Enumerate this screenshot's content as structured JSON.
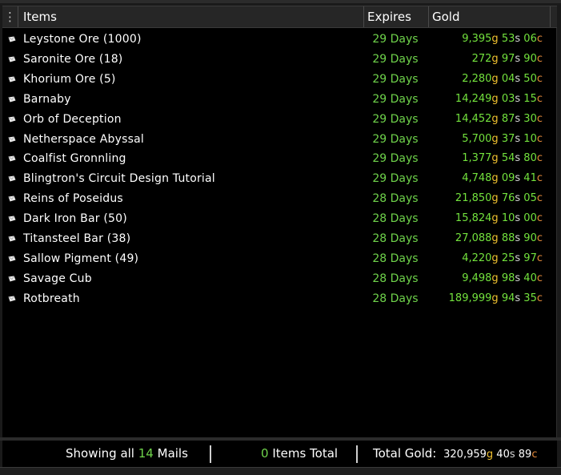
{
  "header": {
    "menu_glyph": "⋮",
    "col_items": "Items",
    "col_expires": "Expires",
    "col_gold": "Gold"
  },
  "rows": [
    {
      "name": "Leystone Ore (1000)",
      "expires": "29 Days",
      "gold": "9,395",
      "silver": "53",
      "copper": "06"
    },
    {
      "name": "Saronite Ore (18)",
      "expires": "29 Days",
      "gold": "272",
      "silver": "97",
      "copper": "90"
    },
    {
      "name": "Khorium Ore (5)",
      "expires": "29 Days",
      "gold": "2,280",
      "silver": "04",
      "copper": "50"
    },
    {
      "name": "Barnaby",
      "expires": "29 Days",
      "gold": "14,249",
      "silver": "03",
      "copper": "15"
    },
    {
      "name": "Orb of Deception",
      "expires": "29 Days",
      "gold": "14,452",
      "silver": "87",
      "copper": "30"
    },
    {
      "name": "Netherspace Abyssal",
      "expires": "29 Days",
      "gold": "5,700",
      "silver": "37",
      "copper": "10"
    },
    {
      "name": "Coalfist Gronnling",
      "expires": "29 Days",
      "gold": "1,377",
      "silver": "54",
      "copper": "80"
    },
    {
      "name": "Blingtron's Circuit Design Tutorial",
      "expires": "29 Days",
      "gold": "4,748",
      "silver": "09",
      "copper": "41"
    },
    {
      "name": "Reins of Poseidus",
      "expires": "28 Days",
      "gold": "21,850",
      "silver": "76",
      "copper": "05"
    },
    {
      "name": "Dark Iron Bar (50)",
      "expires": "28 Days",
      "gold": "15,824",
      "silver": "10",
      "copper": "00"
    },
    {
      "name": "Titansteel Bar (38)",
      "expires": "28 Days",
      "gold": "27,088",
      "silver": "88",
      "copper": "90"
    },
    {
      "name": "Sallow Pigment (49)",
      "expires": "28 Days",
      "gold": "4,220",
      "silver": "25",
      "copper": "97"
    },
    {
      "name": "Savage Cub",
      "expires": "28 Days",
      "gold": "9,498",
      "silver": "98",
      "copper": "40"
    },
    {
      "name": "Rotbreath",
      "expires": "28 Days",
      "gold": "189,999",
      "silver": "94",
      "copper": "35"
    }
  ],
  "units": {
    "g": "g",
    "s": "s",
    "c": "c"
  },
  "footer": {
    "showing_prefix": "Showing all",
    "mail_count": "14",
    "showing_suffix": "Mails",
    "items_count": "0",
    "items_label": "Items Total",
    "total_label": "Total Gold:",
    "total_gold": "320,959",
    "total_silver": "40",
    "total_copper": "89"
  },
  "colors": {
    "expires_green": "#6fd34b",
    "gold_unit": "#f2c230",
    "silver_unit": "#d7d7d7",
    "copper_unit": "#e2883a"
  },
  "icons": {
    "row_icon": "mail-envelope-icon",
    "menu_icon": "vertical-ellipsis-icon"
  }
}
